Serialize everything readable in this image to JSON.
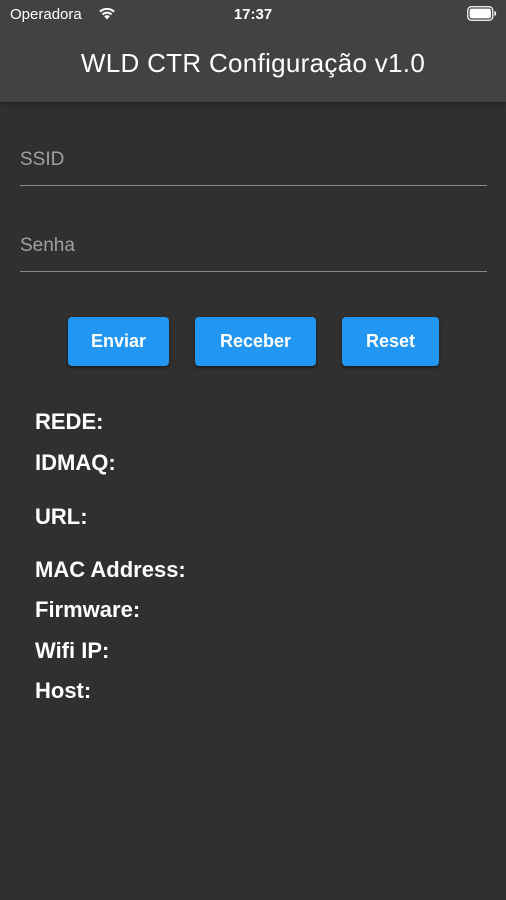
{
  "status_bar": {
    "carrier": "Operadora",
    "time": "17:37",
    "wifi_icon": "wifi-icon",
    "battery_icon": "battery-full-icon"
  },
  "app_bar": {
    "title": "WLD CTR Configuração v1.0"
  },
  "form": {
    "ssid": {
      "placeholder": "SSID",
      "value": ""
    },
    "senha": {
      "placeholder": "Senha",
      "value": ""
    }
  },
  "buttons": {
    "enviar": "Enviar",
    "receber": "Receber",
    "reset": "Reset"
  },
  "info": {
    "rede": "REDE:",
    "idmaq": "IDMAQ:",
    "url": "URL:",
    "mac": "MAC Address:",
    "firmware": "Firmware:",
    "wifi_ip": "Wifi IP:",
    "host": "Host:"
  },
  "colors": {
    "background": "#303030",
    "app_bar": "#424242",
    "button": "#2196f3",
    "text": "#ffffff",
    "placeholder": "#a0a0a0"
  }
}
